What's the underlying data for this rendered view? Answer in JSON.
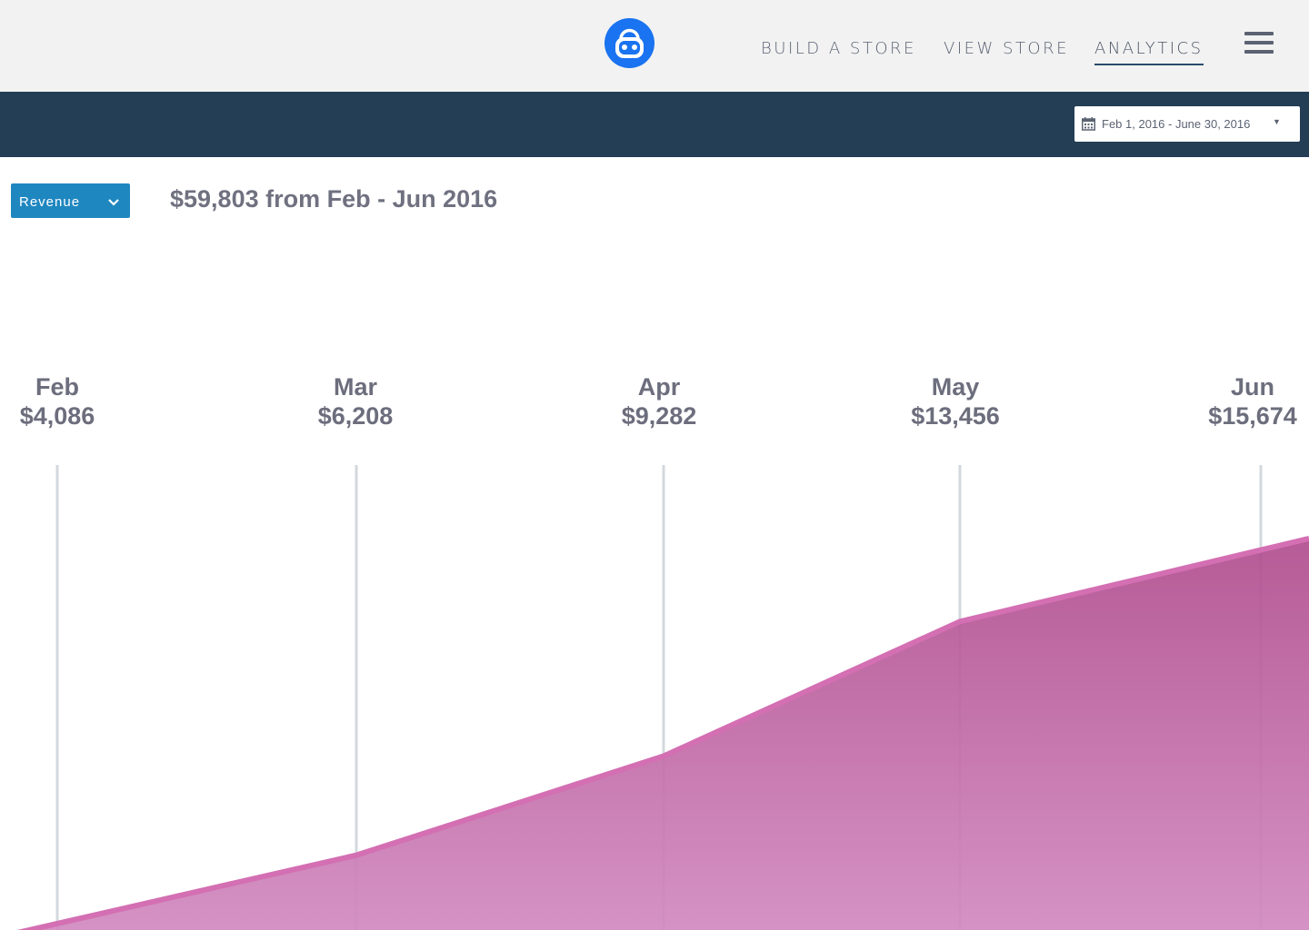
{
  "nav": {
    "logo_icon": "shopping-bag-robot-icon",
    "brand_color": "#1a73f0",
    "links": [
      "BUILD A STORE",
      "VIEW STORE",
      "ANALYTICS"
    ],
    "active": "ANALYTICS",
    "menu_icon": "hamburger-menu-icon"
  },
  "toolbar": {
    "date_range": "Feb 1, 2016 - June 30, 2016",
    "calendar_icon": "calendar-icon",
    "bar_color": "#233e55"
  },
  "metric": {
    "selected": "Revenue",
    "color": "#1f87c0"
  },
  "headline": "$59,803 from Feb - Jun 2016",
  "chart_data": {
    "type": "area",
    "categories": [
      "Feb",
      "Mar",
      "Apr",
      "May",
      "Jun"
    ],
    "value_labels": [
      "$4,086",
      "$6,208",
      "$9,282",
      "$13,456",
      "$15,674"
    ],
    "values": [
      4086,
      6208,
      9282,
      13456,
      15674
    ],
    "title": "",
    "xlabel": "",
    "ylabel": "",
    "grid": true,
    "fill_color": "#c05d9a",
    "line_color": "#d36fb2"
  }
}
